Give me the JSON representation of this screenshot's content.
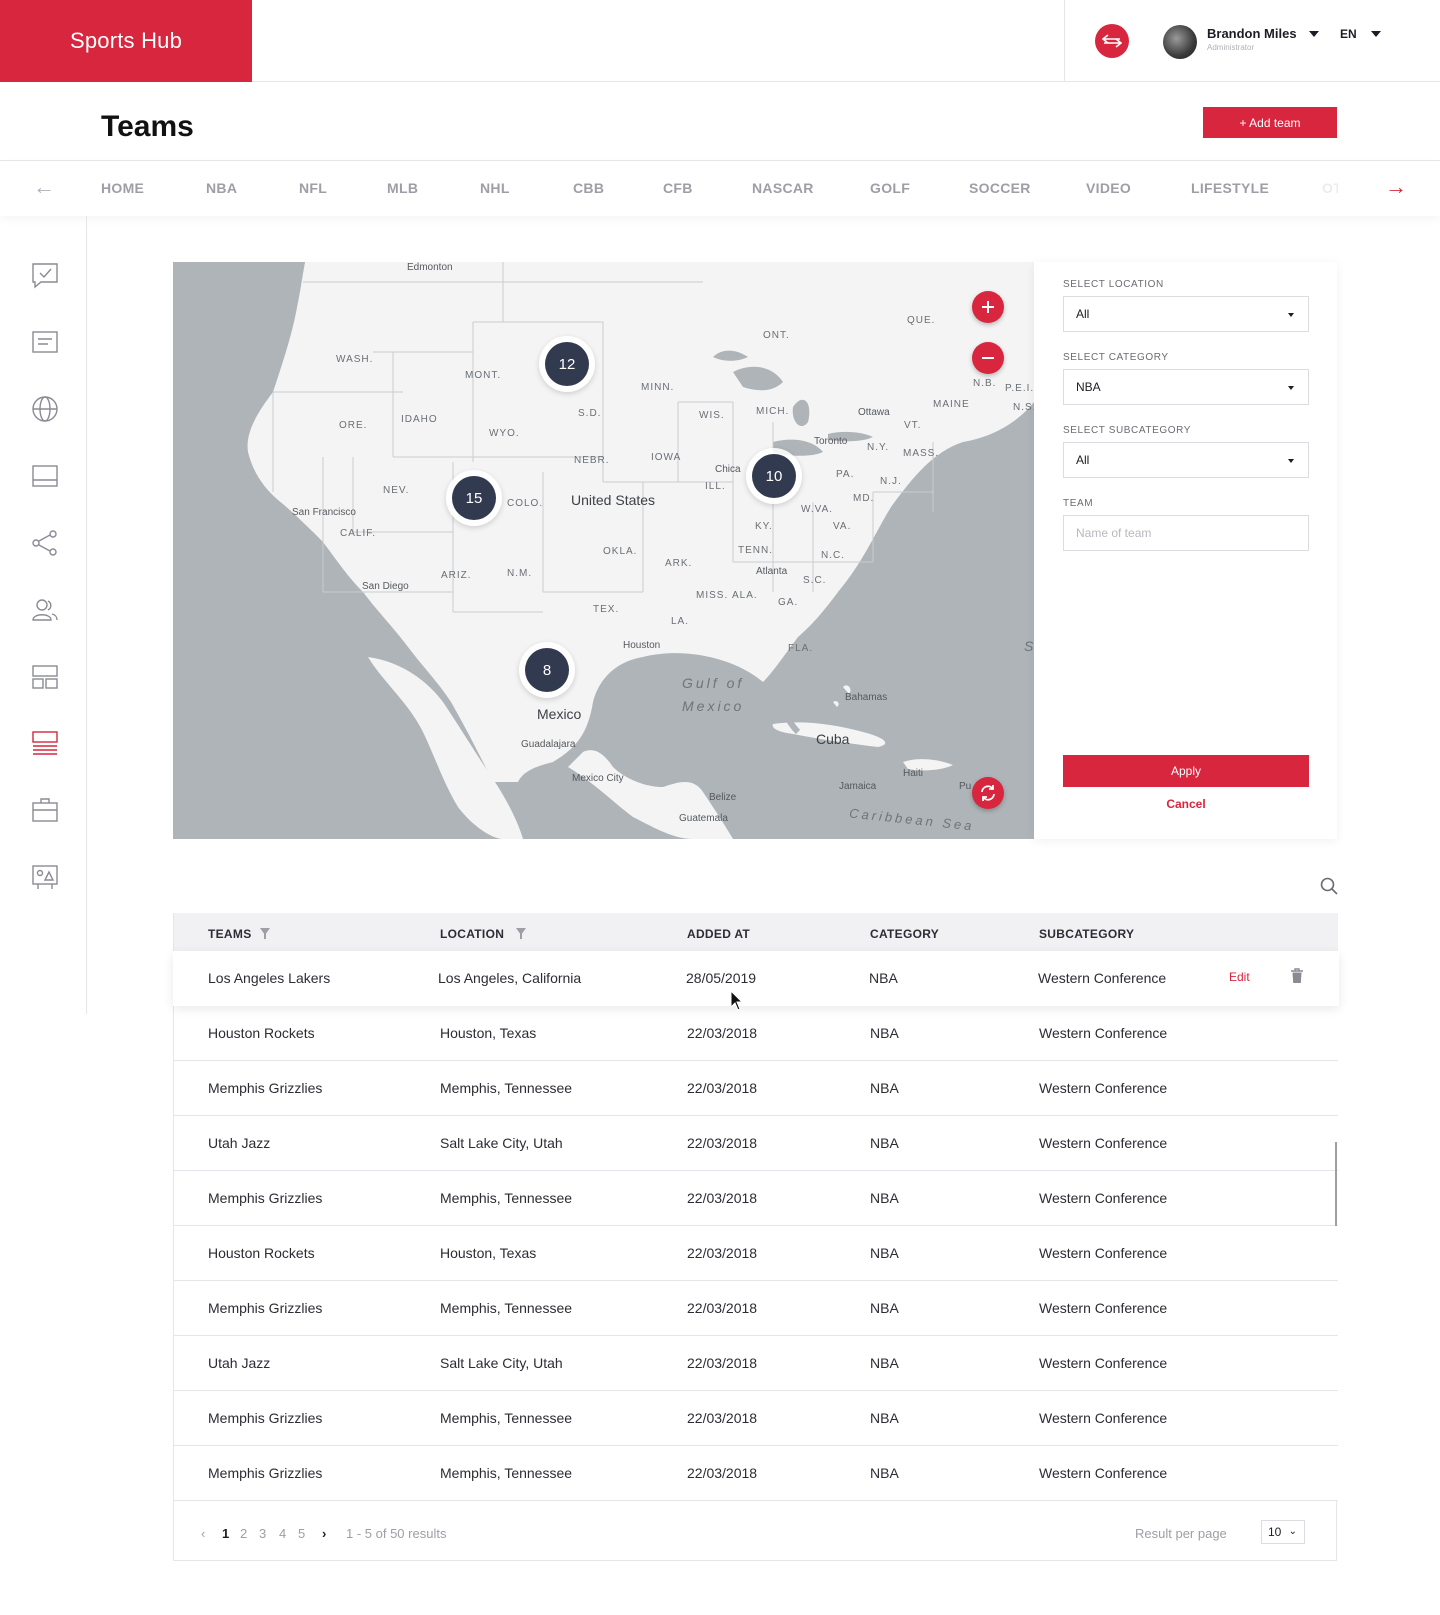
{
  "app": {
    "brand": "Sports Hub"
  },
  "user": {
    "name": "Brandon Miles",
    "role": "Administrator",
    "language": "EN"
  },
  "page": {
    "title": "Teams",
    "add_button": "+ Add team"
  },
  "nav": {
    "items": [
      "HOME",
      "NBA",
      "NFL",
      "MLB",
      "NHL",
      "CBB",
      "CFB",
      "NASCAR",
      "GOLF",
      "SOCCER",
      "VIDEO",
      "LIFESTYLE",
      "OT"
    ]
  },
  "sidebar": {
    "icons": [
      "checklist-icon",
      "document-icon",
      "globe-icon",
      "layout-icon",
      "share-icon",
      "users-icon",
      "grid-layout-icon",
      "list-icon",
      "briefcase-icon",
      "gallery-icon"
    ],
    "active_index": 7
  },
  "map": {
    "clusters": [
      "12",
      "15",
      "10",
      "8"
    ],
    "labels": {
      "edmonton": "Edmonton",
      "wash": "WASH.",
      "mont": "MONT.",
      "ore": "ORE.",
      "idaho": "IDAHO",
      "wyo": "WYO.",
      "sd": "S.D.",
      "minn": "MINN.",
      "nev": "NEV.",
      "calif": "CALIF.",
      "colo": "COLO.",
      "us": "United States",
      "nebr": "NEBR.",
      "iowa": "IOWA",
      "ill": "ILL.",
      "chicago": "Chica",
      "wis": "WIS.",
      "mich": "MICH.",
      "ont": "ONT.",
      "que": "QUE.",
      "nb": "N.B.",
      "pei": "P.E.I.",
      "ns": "N.S.",
      "maine": "MAINE",
      "vt": "VT.",
      "ottawa": "Ottawa",
      "toronto": "Toronto",
      "ny": "N.Y.",
      "mass": "MASS.",
      "pa": "PA.",
      "nj": "N.J.",
      "md": "MD.",
      "wva": "W.VA.",
      "va": "VA.",
      "ky": "KY.",
      "tenn": "TENN.",
      "nc": "N.C.",
      "sc": "S.C.",
      "ga": "GA.",
      "ala": "ALA.",
      "miss": "MISS.",
      "ark": "ARK.",
      "okla": "OKLA.",
      "tex": "TEX.",
      "la": "LA.",
      "nm": "N.M.",
      "ariz": "ARIZ.",
      "sf": "San Francisco",
      "sd_city": "San Diego",
      "houston": "Houston",
      "atlanta": "Atlanta",
      "fla": "FLA.",
      "gulf1": "Gulf of",
      "gulf2": "Mexico",
      "mexico": "Mexico",
      "guadalajara": "Guadalajara",
      "mexico_city": "Mexico City",
      "bahamas": "Bahamas",
      "cuba": "Cuba",
      "haiti": "Haiti",
      "jamaica": "Jamaica",
      "belize": "Belize",
      "guatemala": "Guatemala",
      "caribbean": "Caribbean Sea",
      "pr": "Pu",
      "s_edge": "S"
    }
  },
  "filters": {
    "location": {
      "label": "SELECT LOCATION",
      "value": "All"
    },
    "category": {
      "label": "SELECT CATEGORY",
      "value": "NBA"
    },
    "subcategory": {
      "label": "SELECT SUBCATEGORY",
      "value": "All"
    },
    "team": {
      "label": "TEAM",
      "placeholder": "Name of team"
    },
    "apply": "Apply",
    "cancel": "Cancel"
  },
  "table": {
    "headers": [
      "TEAMS",
      "LOCATION",
      "ADDED AT",
      "CATEGORY",
      "SUBCATEGORY"
    ],
    "edit_label": "Edit",
    "rows": [
      [
        "Los Angeles Lakers",
        "Los Angeles, California",
        "28/05/2019",
        "NBA",
        "Western Conference"
      ],
      [
        "Houston Rockets",
        "Houston, Texas",
        "22/03/2018",
        "NBA",
        "Western Conference"
      ],
      [
        "Memphis Grizzlies",
        "Memphis, Tennessee",
        "22/03/2018",
        "NBA",
        "Western Conference"
      ],
      [
        "Utah Jazz",
        "Salt Lake City, Utah",
        "22/03/2018",
        "NBA",
        "Western Conference"
      ],
      [
        "Memphis Grizzlies",
        "Memphis, Tennessee",
        "22/03/2018",
        "NBA",
        "Western Conference"
      ],
      [
        "Houston Rockets",
        "Houston, Texas",
        "22/03/2018",
        "NBA",
        "Western Conference"
      ],
      [
        "Memphis Grizzlies",
        "Memphis, Tennessee",
        "22/03/2018",
        "NBA",
        "Western Conference"
      ],
      [
        "Utah Jazz",
        "Salt Lake City, Utah",
        "22/03/2018",
        "NBA",
        "Western Conference"
      ],
      [
        "Memphis Grizzlies",
        "Memphis, Tennessee",
        "22/03/2018",
        "NBA",
        "Western Conference"
      ],
      [
        "Memphis Grizzlies",
        "Memphis, Tennessee",
        "22/03/2018",
        "NBA",
        "Western Conference"
      ]
    ]
  },
  "pagination": {
    "pages": [
      "1",
      "2",
      "3",
      "4",
      "5"
    ],
    "current": "1",
    "summary": "1 - 5 of 50 results",
    "per_page_label": "Result per page",
    "per_page": "10"
  },
  "colors": {
    "accent": "#d7263d",
    "cluster": "#323a4f",
    "map_land": "#f4f4f4",
    "map_water": "#aeb4b8"
  }
}
